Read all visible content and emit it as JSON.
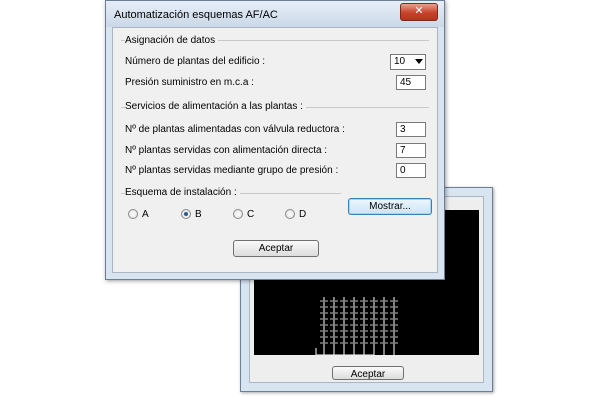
{
  "back_window": {
    "ok_label": "Aceptar"
  },
  "dialog": {
    "title": "Automatización esquemas AF/AC",
    "close_glyph": "✕",
    "asignacion": {
      "title": "Asignación de datos",
      "plantas_label": "Número de plantas del edificio :",
      "plantas_value": "10",
      "presion_label": "Presión suministro en m.c.a :",
      "presion_value": "45"
    },
    "servicios": {
      "title": "Servicios de alimentación a las plantas :",
      "rows": [
        {
          "label": "Nº de plantas alimentadas con válvula reductora :",
          "value": "3"
        },
        {
          "label": "Nº plantas servidas con alimentación directa :",
          "value": "7"
        },
        {
          "label": "Nº plantas servidas mediante grupo de presión :",
          "value": "0"
        }
      ]
    },
    "esquema": {
      "title": "Esquema de instalación :",
      "options": [
        "A",
        "B",
        "C",
        "D"
      ],
      "selected": "B",
      "mostrar_label": "Mostrar..."
    },
    "ok_label": "Aceptar"
  },
  "colors": {
    "frame": "#d9e4f1",
    "close_button": "#c8422a",
    "preview_bg": "#000000",
    "diagram_lines": "#ffffff"
  }
}
